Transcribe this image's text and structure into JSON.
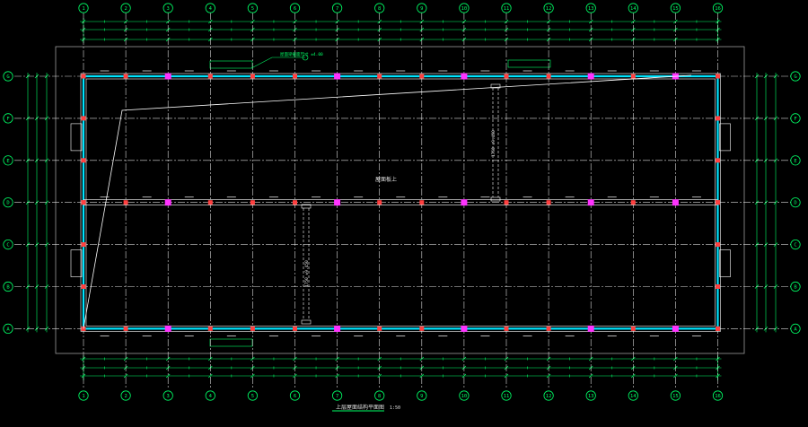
{
  "drawing": {
    "title": "上层屋面结构平面图",
    "scale": "1:50",
    "center_label": "屋面板上",
    "top_note": "屋面梁截面尺寸 ±4.00",
    "beam_note_right": "1750 ±9.450",
    "beam_note_left": "1750 ±9.450"
  },
  "grid": {
    "columns": [
      "1",
      "2",
      "3",
      "4",
      "5",
      "6",
      "7",
      "8",
      "9",
      "10",
      "11",
      "12",
      "13",
      "14",
      "15",
      "16"
    ],
    "rows": [
      "G",
      "F",
      "E",
      "D",
      "C",
      "B",
      "A"
    ]
  },
  "colors": {
    "grid_line": "#ffffff",
    "dimension": "#00ff66",
    "wall": "#00e5ff",
    "column_mark": "#ff33ff",
    "node": "#ff4040",
    "frame": "#9a9a9a",
    "text": "#e0e0e0"
  }
}
